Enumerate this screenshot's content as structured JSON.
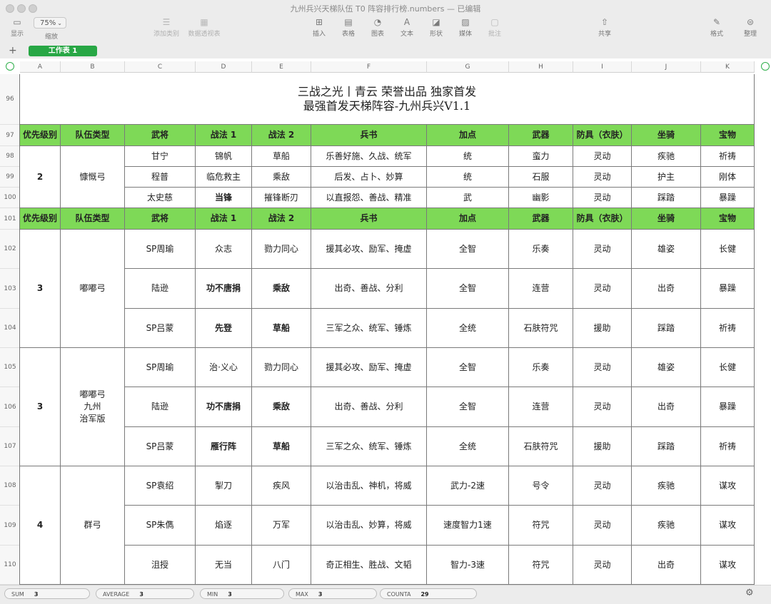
{
  "window": {
    "title": "九州兵兴天梯队伍 T0 阵容排行榜.numbers",
    "status": "— 已编辑"
  },
  "toolbar": {
    "view": "显示",
    "zoom_value": "75%",
    "zoom": "缩放",
    "add_category": "添加类别",
    "pivot_table": "数据透视表",
    "insert": "插入",
    "table": "表格",
    "chart": "图表",
    "text": "文本",
    "shape": "形状",
    "media": "媒体",
    "comment": "批注",
    "share": "共享",
    "format": "格式",
    "organize": "整理"
  },
  "sheet_tab": "工作表 1",
  "columns": [
    "A",
    "B",
    "C",
    "D",
    "E",
    "F",
    "G",
    "H",
    "I",
    "J",
    "K"
  ],
  "row_numbers": [
    "96",
    "97",
    "98",
    "99",
    "100",
    "101",
    "102",
    "103",
    "104",
    "105",
    "106",
    "107",
    "108",
    "109",
    "110"
  ],
  "title": {
    "line1": "三战之光丨青云  荣誉出品  独家首发",
    "line2": "最强首发天梯阵容-九州兵兴V1.1"
  },
  "header": [
    "优先级别",
    "队伍类型",
    "武将",
    "战法 1",
    "战法 2",
    "兵书",
    "加点",
    "武器",
    "防具（衣肤）",
    "坐骑",
    "宝物"
  ],
  "group1": {
    "priority": "2",
    "type": "慷慨弓",
    "rows": [
      [
        "甘宁",
        "锦帆",
        "草船",
        "乐善好施、久战、统军",
        "统",
        "蛮力",
        "灵动",
        "疾驰",
        "祈祷"
      ],
      [
        "程普",
        "临危救主",
        "乘敌",
        "后发、占卜、妙算",
        "统",
        "石服",
        "灵动",
        "护主",
        "刚体"
      ],
      [
        "太史慈",
        "当锋",
        "摧锋断刃",
        "以直报怨、善战、精准",
        "武",
        "幽影",
        "灵动",
        "踩踏",
        "暴躁"
      ]
    ]
  },
  "group2": {
    "priority": "3",
    "type": "嘟嘟弓",
    "rows": [
      [
        "SP周瑜",
        "众志",
        "勠力同心",
        "援其必攻、励军、掩虚",
        "全智",
        "乐奏",
        "灵动",
        "雄姿",
        "长健"
      ],
      [
        "陆逊",
        "功不唐捐",
        "乘敌",
        "出奇、善战、分利",
        "全智",
        "连营",
        "灵动",
        "出奇",
        "暴躁"
      ],
      [
        "SP吕蒙",
        "先登",
        "草船",
        "三军之众、统军、锤炼",
        "全统",
        "石肤符咒",
        "援助",
        "踩踏",
        "祈祷"
      ]
    ]
  },
  "group3": {
    "priority": "3",
    "type1": "嘟嘟弓",
    "type2": "九州",
    "type3": "治军版",
    "rows": [
      [
        "SP周瑜",
        "治·义心",
        "勠力同心",
        "援其必攻、励军、掩虚",
        "全智",
        "乐奏",
        "灵动",
        "雄姿",
        "长健"
      ],
      [
        "陆逊",
        "功不唐捐",
        "乘敌",
        "出奇、善战、分利",
        "全智",
        "连营",
        "灵动",
        "出奇",
        "暴躁"
      ],
      [
        "SP吕蒙",
        "雁行阵",
        "草船",
        "三军之众、统军、锤炼",
        "全统",
        "石肤符咒",
        "援助",
        "踩踏",
        "祈祷"
      ]
    ]
  },
  "group4": {
    "priority": "4",
    "type": "群弓",
    "rows": [
      [
        "SP袁绍",
        "掣刀",
        "疾风",
        "以治击乱、神机，将威",
        "武力-2速",
        "号令",
        "灵动",
        "疾驰",
        "谋攻"
      ],
      [
        "SP朱儁",
        "焰逐",
        "万军",
        "以治击乱、妙算，将威",
        "速度智力1速",
        "符咒",
        "灵动",
        "疾驰",
        "谋攻"
      ],
      [
        "沮授",
        "无当",
        "八门",
        "奇正相生、胜战、文韬",
        "智力-3速",
        "符咒",
        "灵动",
        "出奇",
        "谋攻"
      ]
    ]
  },
  "status": {
    "sum_label": "SUM",
    "sum": "3",
    "avg_label": "AVERAGE",
    "avg": "3",
    "min_label": "MIN",
    "min": "3",
    "max_label": "MAX",
    "max": "3",
    "counta_label": "COUNTA",
    "counta": "29"
  }
}
